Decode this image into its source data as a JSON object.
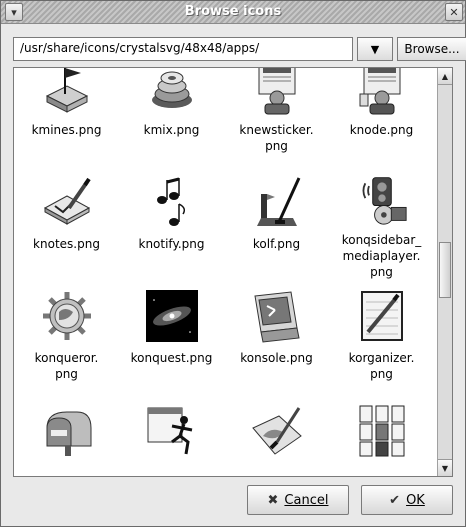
{
  "window": {
    "title": "Browse icons",
    "menu_icon": "chevron-down-icon",
    "close_icon": "close-icon"
  },
  "path": {
    "value": "/usr/share/icons/crystalsvg/48x48/apps/",
    "dropdown_icon": "chevron-down-icon",
    "browse_label": "Browse..."
  },
  "icons": [
    {
      "label": "kmines.png",
      "icon": "mines-icon"
    },
    {
      "label": "kmix.png",
      "icon": "mixer-icon"
    },
    {
      "label": "knewsticker.\npng",
      "icon": "newspaper-icon"
    },
    {
      "label": "knode.png",
      "icon": "newsreader-icon"
    },
    {
      "label": "knotes.png",
      "icon": "notes-icon"
    },
    {
      "label": "knotify.png",
      "icon": "music-notes-icon"
    },
    {
      "label": "kolf.png",
      "icon": "golf-icon"
    },
    {
      "label": "konqsidebar_\nmediaplayer.\npng",
      "icon": "media-player-icon"
    },
    {
      "label": "konqueror.\npng",
      "icon": "globe-gear-icon"
    },
    {
      "label": "konquest.png",
      "icon": "galaxy-icon"
    },
    {
      "label": "konsole.png",
      "icon": "terminal-icon"
    },
    {
      "label": "korganizer.\npng",
      "icon": "organizer-icon"
    },
    {
      "label": "",
      "icon": "mailbox-icon"
    },
    {
      "label": "",
      "icon": "window-runner-icon"
    },
    {
      "label": "",
      "icon": "paint-icon"
    },
    {
      "label": "",
      "icon": "patience-cards-icon"
    }
  ],
  "buttons": {
    "cancel_label": "Cancel",
    "cancel_icon": "cancel-x-icon",
    "ok_label": "OK",
    "ok_icon": "check-icon"
  }
}
